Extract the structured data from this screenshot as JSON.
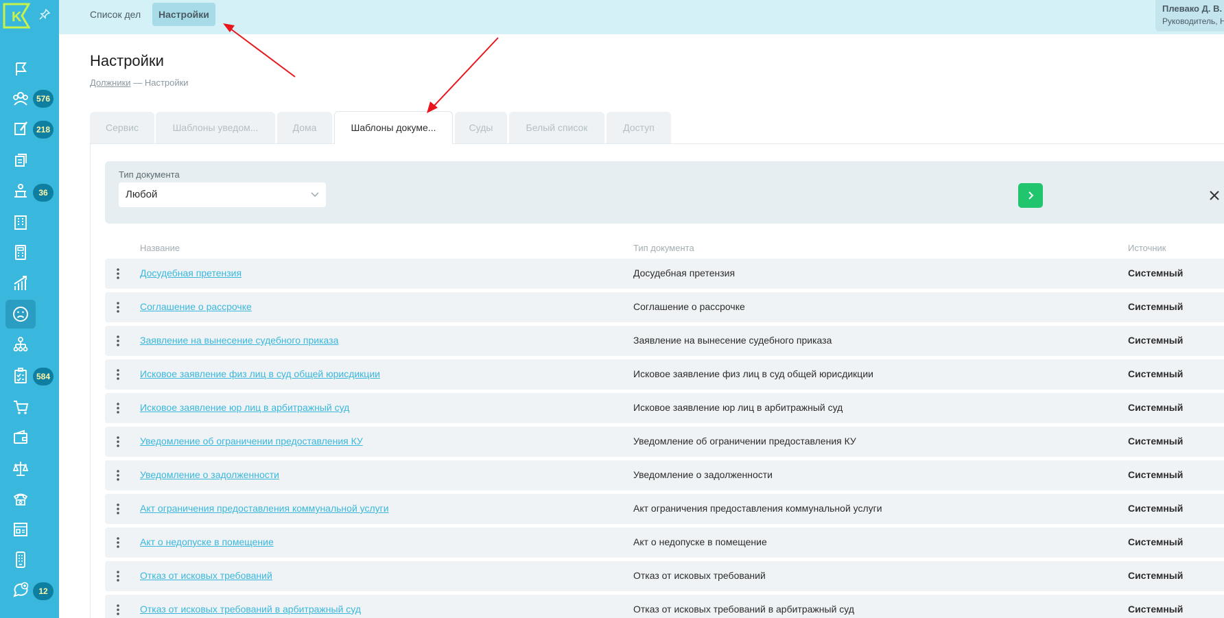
{
  "colors": {
    "sidebar": "#3ab7dc",
    "topbar": "#d4f1f8",
    "accent_green": "#20c56e",
    "badge": "#0e7fa0",
    "link": "#3ab7dc",
    "arrow": "#e8161c"
  },
  "sidebar": {
    "logo_letter": "K",
    "pin_icon": "pin-icon",
    "items": [
      {
        "icon": "flag-icon",
        "badge": ""
      },
      {
        "icon": "debtors-group-icon",
        "badge": "576"
      },
      {
        "icon": "edit-document-icon",
        "badge": "218"
      },
      {
        "icon": "documents-stack-icon",
        "badge": ""
      },
      {
        "icon": "court-bench-icon",
        "badge": "36"
      },
      {
        "icon": "building-icon",
        "badge": ""
      },
      {
        "icon": "calculator-icon",
        "badge": ""
      },
      {
        "icon": "growth-chart-icon",
        "badge": ""
      },
      {
        "icon": "sad-face-icon",
        "badge": ""
      },
      {
        "icon": "org-structure-icon",
        "badge": ""
      },
      {
        "icon": "checklist-icon",
        "badge": "584"
      },
      {
        "icon": "cart-icon",
        "badge": ""
      },
      {
        "icon": "wallet-icon",
        "badge": ""
      },
      {
        "icon": "scales-icon",
        "badge": ""
      },
      {
        "icon": "phone-icon",
        "badge": ""
      },
      {
        "icon": "window-panel-icon",
        "badge": ""
      },
      {
        "icon": "mobile-device-icon",
        "badge": ""
      },
      {
        "icon": "chat-add-icon",
        "badge": "12"
      }
    ]
  },
  "topbar": {
    "links": [
      "Список дел",
      "Настройки"
    ],
    "active": "Настройки",
    "user_name": "Плевако Д. В.",
    "user_role": "Руководитель, Н"
  },
  "page": {
    "title": "Настройки",
    "breadcrumb_link": "Должники",
    "breadcrumb_sep": "—",
    "breadcrumb_current": "Настройки"
  },
  "tabs": [
    "Сервис",
    "Шаблоны уведом...",
    "Дома",
    "Шаблоны докуме...",
    "Суды",
    "Белый список",
    "Доступ"
  ],
  "active_tab": "Шаблоны докуме...",
  "filter": {
    "label": "Тип документа",
    "value": "Любой"
  },
  "table": {
    "headers": [
      "Название",
      "Тип документа",
      "Источник"
    ],
    "rows": [
      {
        "name": "Досудебная претензия",
        "type": "Досудебная претензия",
        "source": "Системный"
      },
      {
        "name": "Соглашение о рассрочке",
        "type": "Соглашение о рассрочке",
        "source": "Системный"
      },
      {
        "name": "Заявление на вынесение судебного приказа",
        "type": "Заявление на вынесение судебного приказа",
        "source": "Системный"
      },
      {
        "name": "Исковое заявление физ лиц в суд общей юрисдикции",
        "type": "Исковое заявление физ лиц в суд общей юрисдикции",
        "source": "Системный"
      },
      {
        "name": "Исковое заявление юр лиц в арбитражный суд",
        "type": "Исковое заявление юр лиц в арбитражный суд",
        "source": "Системный"
      },
      {
        "name": "Уведомление об ограничении предоставления КУ",
        "type": "Уведомление об ограничении предоставления КУ",
        "source": "Системный"
      },
      {
        "name": "Уведомление о задолженности",
        "type": "Уведомление о задолженности",
        "source": "Системный"
      },
      {
        "name": "Акт ограничения предоставления коммунальной услуги",
        "type": "Акт ограничения предоставления коммунальной услуги",
        "source": "Системный"
      },
      {
        "name": "Акт о недопуске в помещение",
        "type": "Акт о недопуске в помещение",
        "source": "Системный"
      },
      {
        "name": "Отказ от исковых требований",
        "type": "Отказ от исковых требований",
        "source": "Системный"
      },
      {
        "name": "Отказ от исковых требований в арбитражный суд",
        "type": "Отказ от исковых требований в арбитражный суд",
        "source": "Системный"
      }
    ]
  }
}
